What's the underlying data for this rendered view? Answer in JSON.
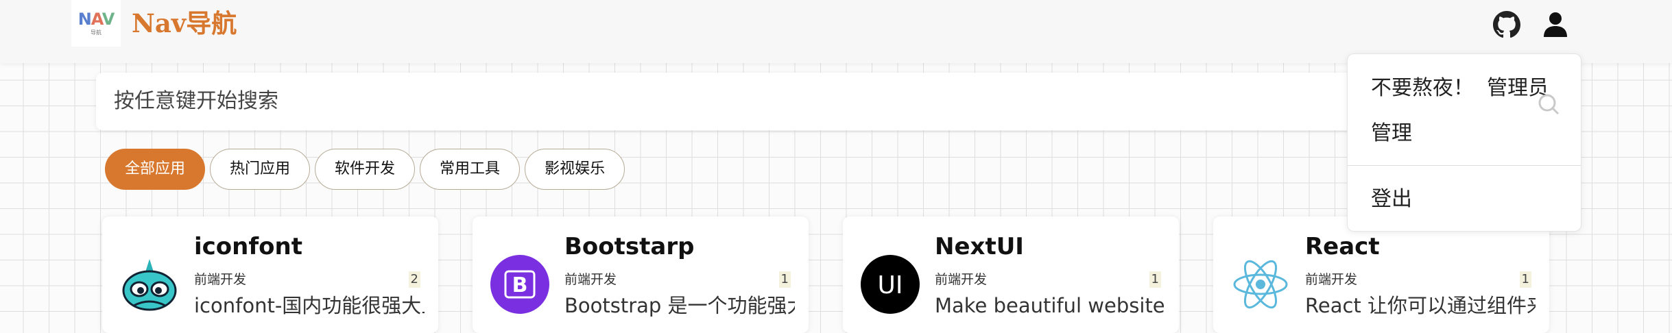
{
  "header": {
    "logo_text": "NAV",
    "logo_sub": "导航",
    "brand": "Nav导航"
  },
  "search": {
    "placeholder": "按任意键开始搜索"
  },
  "tabs": [
    {
      "label": "全部应用",
      "active": true
    },
    {
      "label": "热门应用",
      "active": false
    },
    {
      "label": "软件开发",
      "active": false
    },
    {
      "label": "常用工具",
      "active": false
    },
    {
      "label": "影视娱乐",
      "active": false
    }
  ],
  "cards": [
    {
      "title": "iconfont",
      "category": "前端开发",
      "count": "2",
      "description": "iconfont-国内功能很强大且图标内容很丰富的矢量",
      "icon": "iconfont-logo"
    },
    {
      "title": "Bootstarp",
      "category": "前端开发",
      "count": "1",
      "description": "Bootstrap 是一个功能强大、功能丰富的前端工具包",
      "icon": "bootstrap-logo"
    },
    {
      "title": "NextUI",
      "category": "前端开发",
      "count": "1",
      "description": "Make beautiful websites regardless of your",
      "icon": "nextui-logo"
    },
    {
      "title": "React",
      "category": "前端开发",
      "count": "1",
      "description": "React 让你可以通过组件来构建用户界面，你可以创",
      "icon": "react-logo"
    }
  ],
  "user_menu": {
    "greeting": "不要熬夜！",
    "role": "管理员",
    "admin": "管理",
    "logout": "登出"
  },
  "colors": {
    "accent": "#d8782f",
    "tab_border": "#b7ab96"
  }
}
